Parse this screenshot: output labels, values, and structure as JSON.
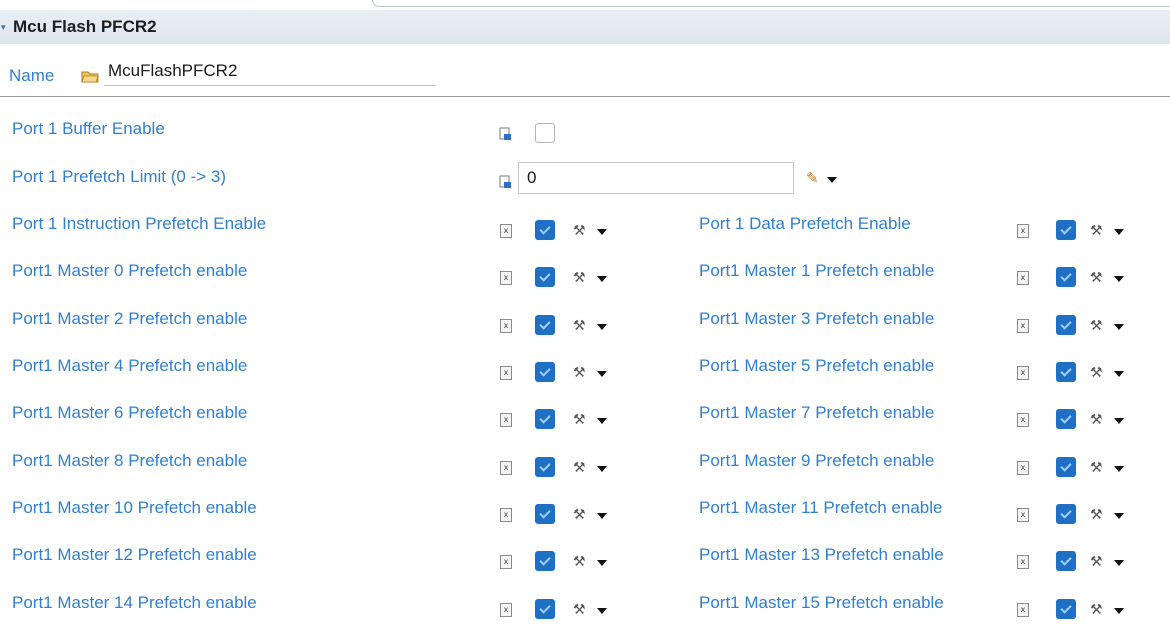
{
  "section": {
    "title": "Mcu Flash PFCR2"
  },
  "name": {
    "label": "Name",
    "value": "McuFlashPFCR2"
  },
  "buffer_enable": {
    "label": "Port 1 Buffer Enable",
    "checked": false
  },
  "prefetch_limit": {
    "label": "Port 1 Prefetch Limit (0 -> 3)",
    "value": "0"
  },
  "rows": [
    {
      "left": {
        "label": "Port 1 Instruction Prefetch Enable",
        "checked": true
      },
      "right": {
        "label": "Port 1 Data Prefetch Enable",
        "checked": true
      }
    },
    {
      "left": {
        "label": "Port1 Master 0 Prefetch enable",
        "checked": true
      },
      "right": {
        "label": "Port1 Master 1 Prefetch enable",
        "checked": true
      }
    },
    {
      "left": {
        "label": "Port1 Master 2 Prefetch enable",
        "checked": true
      },
      "right": {
        "label": "Port1 Master 3 Prefetch enable",
        "checked": true
      }
    },
    {
      "left": {
        "label": "Port1 Master 4 Prefetch enable",
        "checked": true
      },
      "right": {
        "label": "Port1 Master 5 Prefetch enable",
        "checked": true
      }
    },
    {
      "left": {
        "label": "Port1 Master 6 Prefetch enable",
        "checked": true
      },
      "right": {
        "label": "Port1 Master 7 Prefetch enable",
        "checked": true
      }
    },
    {
      "left": {
        "label": "Port1 Master 8 Prefetch enable",
        "checked": true
      },
      "right": {
        "label": "Port1 Master 9 Prefetch enable",
        "checked": true
      }
    },
    {
      "left": {
        "label": "Port1 Master 10 Prefetch enable",
        "checked": true
      },
      "right": {
        "label": "Port1 Master 11 Prefetch enable",
        "checked": true
      }
    },
    {
      "left": {
        "label": "Port1 Master 12 Prefetch enable",
        "checked": true
      },
      "right": {
        "label": "Port1 Master 13 Prefetch enable",
        "checked": true
      }
    },
    {
      "left": {
        "label": "Port1 Master 14 Prefetch enable",
        "checked": true
      },
      "right": {
        "label": "Port1 Master 15 Prefetch enable",
        "checked": true
      }
    }
  ],
  "icons": {
    "name_field": "folder-icon",
    "parameter": "parameter-doc-icon",
    "boolean": "boolean-x-icon",
    "tool": "wrench-icon",
    "edit": "pencil-icon",
    "dropdown": "caret-down-icon"
  },
  "colors": {
    "label": "#2f7fd2",
    "checkbox": "#1f6fc5",
    "header_bg": "#e3e9f1"
  }
}
